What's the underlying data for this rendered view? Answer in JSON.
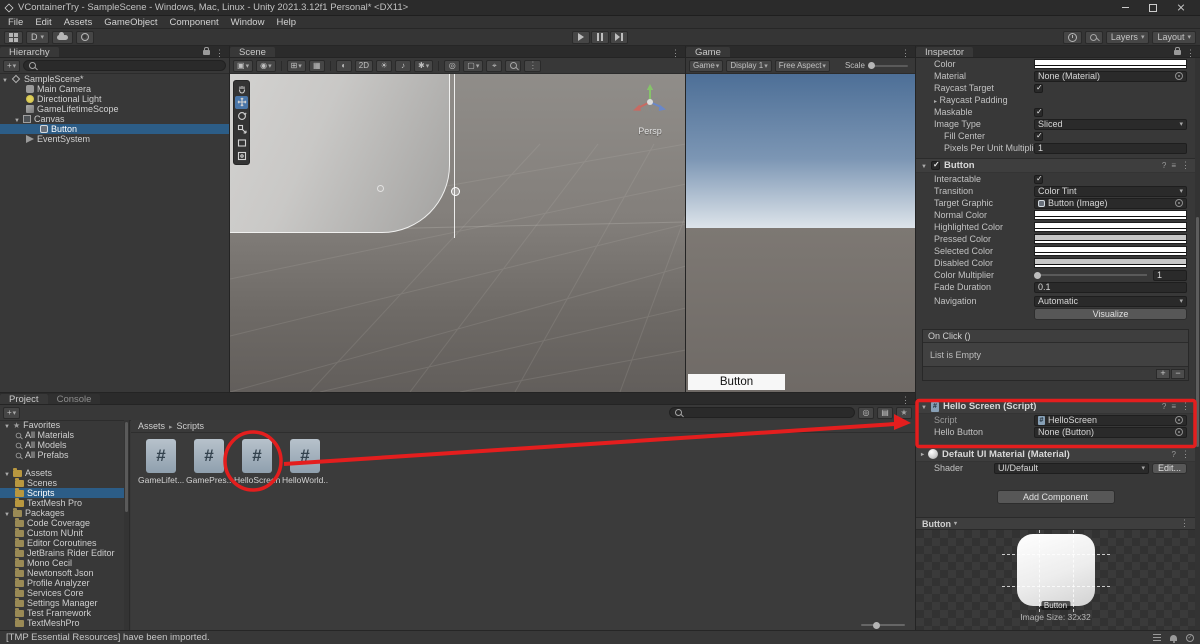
{
  "window": {
    "title": "VContainerTry - SampleScene - Windows, Mac, Linux - Unity 2021.3.12f1 Personal* <DX11>"
  },
  "menu": {
    "items": [
      "File",
      "Edit",
      "Assets",
      "GameObject",
      "Component",
      "Window",
      "Help"
    ]
  },
  "toolbar": {
    "account": "D",
    "layers": "Layers",
    "layout": "Layout"
  },
  "hierarchy": {
    "tab": "Hierarchy",
    "items": [
      {
        "label": "SampleScene*"
      },
      {
        "label": "Main Camera"
      },
      {
        "label": "Directional Light"
      },
      {
        "label": "GameLifetimeScope"
      },
      {
        "label": "Canvas"
      },
      {
        "label": "Button"
      },
      {
        "label": "EventSystem"
      }
    ]
  },
  "scene": {
    "tab": "Scene",
    "mode_2d": "2D",
    "projection": "Persp"
  },
  "game": {
    "tab": "Game",
    "menu_label": "Game",
    "display": "Display 1",
    "aspect": "Free Aspect",
    "scale": "Scale",
    "button_label": "Button"
  },
  "inspector": {
    "tab": "Inspector",
    "image": {
      "color": "Color",
      "material": "Material",
      "material_value": "None (Material)",
      "raycast_target": "Raycast Target",
      "raycast_padding": "Raycast Padding",
      "maskable": "Maskable",
      "image_type": "Image Type",
      "image_type_value": "Sliced",
      "fill_center": "Fill Center",
      "ppu": "Pixels Per Unit Multiplier",
      "ppu_value": "1"
    },
    "button": {
      "title": "Button",
      "interactable": "Interactable",
      "transition": "Transition",
      "transition_value": "Color Tint",
      "target_graphic": "Target Graphic",
      "target_graphic_value": "Button (Image)",
      "normal_color": "Normal Color",
      "highlighted_color": "Highlighted Color",
      "pressed_color": "Pressed Color",
      "selected_color": "Selected Color",
      "disabled_color": "Disabled Color",
      "color_multiplier": "Color Multiplier",
      "color_multiplier_value": "1",
      "fade_duration": "Fade Duration",
      "fade_duration_value": "0.1",
      "navigation": "Navigation",
      "navigation_value": "Automatic",
      "visualize": "Visualize"
    },
    "on_click": {
      "title": "On Click ()",
      "empty": "List is Empty"
    },
    "hello_screen": {
      "title": "Hello Screen (Script)",
      "script": "Script",
      "script_value": "HelloScreen",
      "hello_button": "Hello Button",
      "hello_button_value": "None (Button)"
    },
    "material_section": {
      "title": "Default UI Material (Material)",
      "shader": "Shader",
      "shader_value": "UI/Default",
      "edit": "Edit..."
    },
    "add_component": "Add Component",
    "preview": {
      "title": "Button",
      "sprite_label": "Button",
      "image_size": "Image Size: 32x32"
    }
  },
  "project": {
    "tab": "Project",
    "console_tab": "Console",
    "breadcrumb": {
      "root": "Assets",
      "current": "Scripts"
    },
    "favorites": {
      "label": "Favorites",
      "items": [
        "All Materials",
        "All Models",
        "All Prefabs"
      ]
    },
    "assets": {
      "label": "Assets",
      "items": [
        "Scenes",
        "Scripts",
        "TextMesh Pro"
      ]
    },
    "packages": {
      "label": "Packages",
      "items": [
        "Code Coverage",
        "Custom NUnit",
        "Editor Coroutines",
        "JetBrains Rider Editor",
        "Mono Cecil",
        "Newtonsoft Json",
        "Profile Analyzer",
        "Services Core",
        "Settings Manager",
        "Test Framework",
        "TextMeshPro"
      ]
    },
    "files": [
      {
        "label": "GameLifet..."
      },
      {
        "label": "GamePres..."
      },
      {
        "label": "HelloScreen"
      },
      {
        "label": "HelloWorld..."
      }
    ]
  },
  "status": {
    "message": "[TMP Essential Resources] have been imported."
  },
  "colors": {
    "annotation_red": "#e41e1e",
    "selection_blue": "#2c5d87",
    "tool_accent": "#4a76a8"
  }
}
